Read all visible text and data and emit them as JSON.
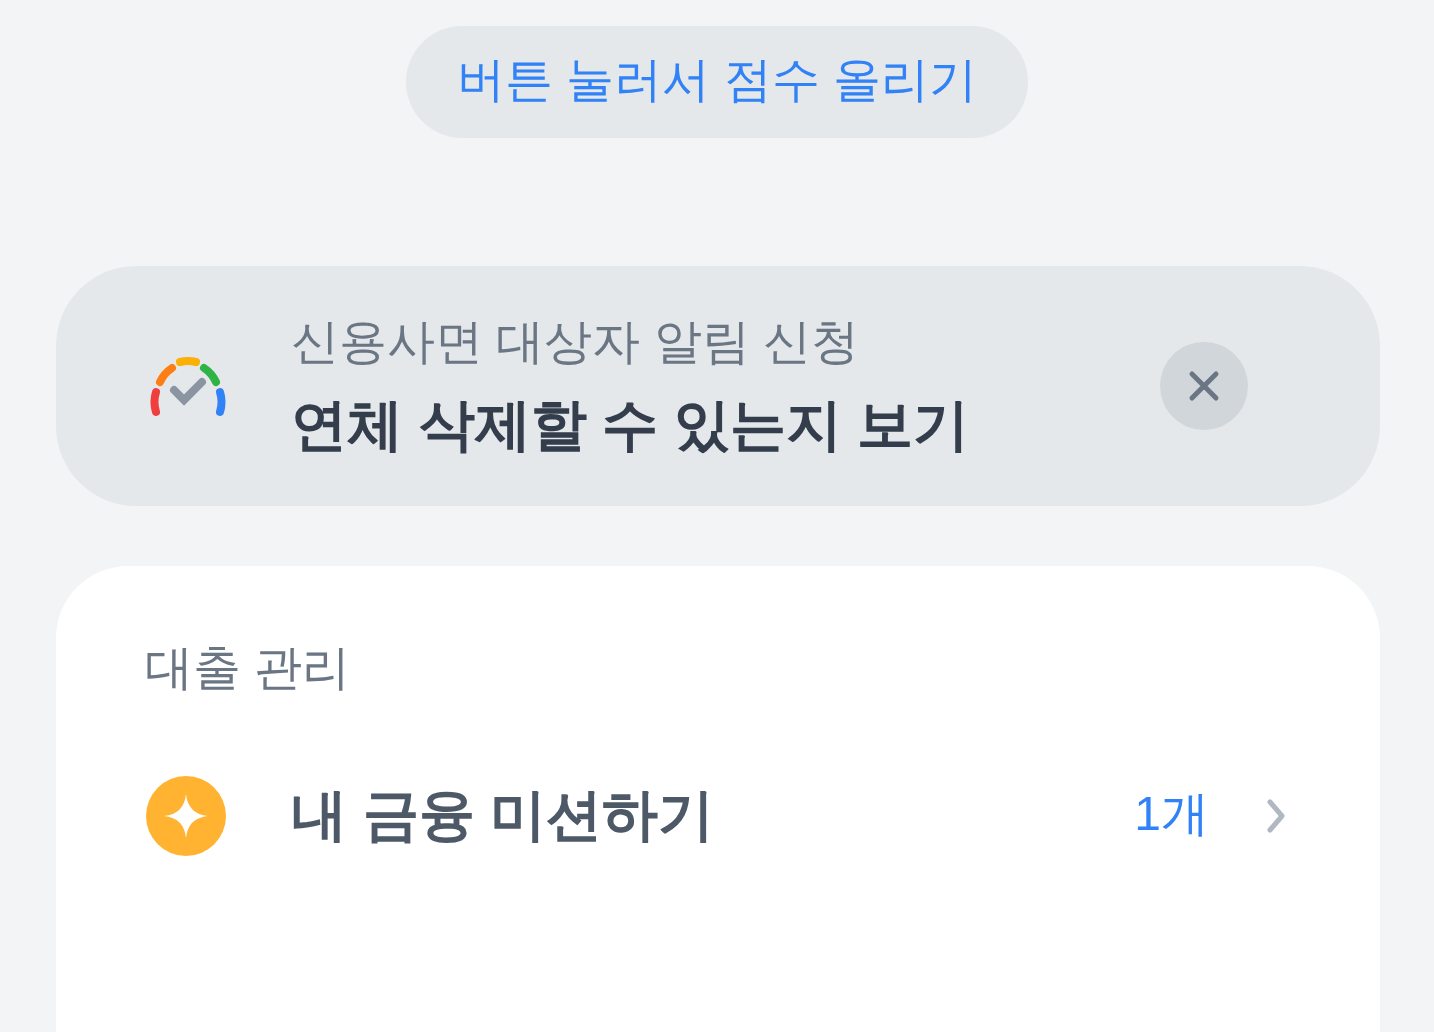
{
  "score_button": {
    "label": "버튼 눌러서 점수 올리기"
  },
  "notice_card": {
    "subtitle": "신용사면 대상자 알림 신청",
    "title": "연체 삭제할 수 있는지 보기"
  },
  "loan_section": {
    "heading": "대출 관리",
    "items": [
      {
        "label": "내 금융 미션하기",
        "count": "1개"
      }
    ]
  }
}
